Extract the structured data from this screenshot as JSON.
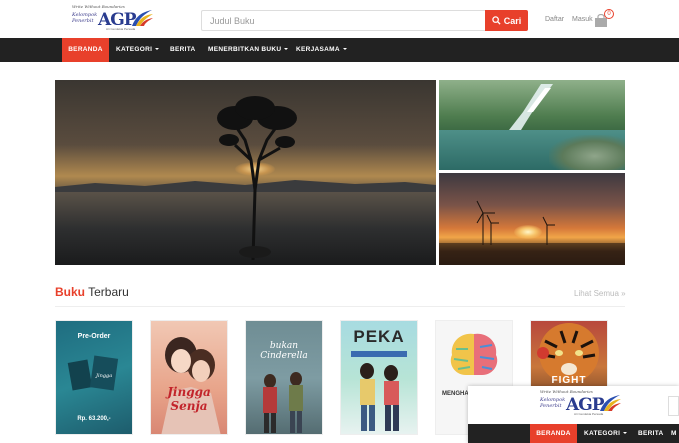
{
  "header": {
    "logo": {
      "tagline": "Write Without Boundaries",
      "left_line1": "Kelompok",
      "left_line2": "Penerbit",
      "main": "AGP",
      "sub": "Ari Cendekia Persada"
    },
    "search": {
      "placeholder": "Judul Buku",
      "button_label": "Cari"
    },
    "auth": {
      "register_label": "Daftar",
      "login_label": "Masuk"
    },
    "cart_count": "0"
  },
  "nav": {
    "items": [
      {
        "label": "BERANDA",
        "active": true
      },
      {
        "label": "KATEGORI",
        "dropdown": true
      },
      {
        "label": "BERITA"
      },
      {
        "label": "MENERBITKAN BUKU",
        "dropdown": true
      },
      {
        "label": "KERJASAMA",
        "dropdown": true
      }
    ]
  },
  "section": {
    "title_accent": "Buku",
    "title_rest": "Terbaru",
    "see_all": "Lihat Semua »"
  },
  "books": [
    {
      "cover_title": "Pre-Order",
      "cover_sub": "",
      "price": "Rp. 63.200,-"
    },
    {
      "cover_title": "Jingga Senja",
      "cover_sub": "",
      "price": ""
    },
    {
      "cover_title": "bukan Cinderella",
      "cover_sub": "",
      "price": ""
    },
    {
      "cover_title": "PEKA",
      "cover_sub": "",
      "price": ""
    },
    {
      "cover_title": "MENGHA... OTAK",
      "cover_sub": "",
      "price": ""
    },
    {
      "cover_title": "FIGHT",
      "cover_sub": "",
      "price": ""
    }
  ],
  "float_bar": {
    "nav": [
      {
        "label": "BERANDA",
        "active": true
      },
      {
        "label": "KATEGORI",
        "dropdown": true
      },
      {
        "label": "BERITA"
      },
      {
        "label": "M"
      }
    ]
  },
  "colors": {
    "accent": "#e8402b",
    "nav_bg": "#222222"
  }
}
